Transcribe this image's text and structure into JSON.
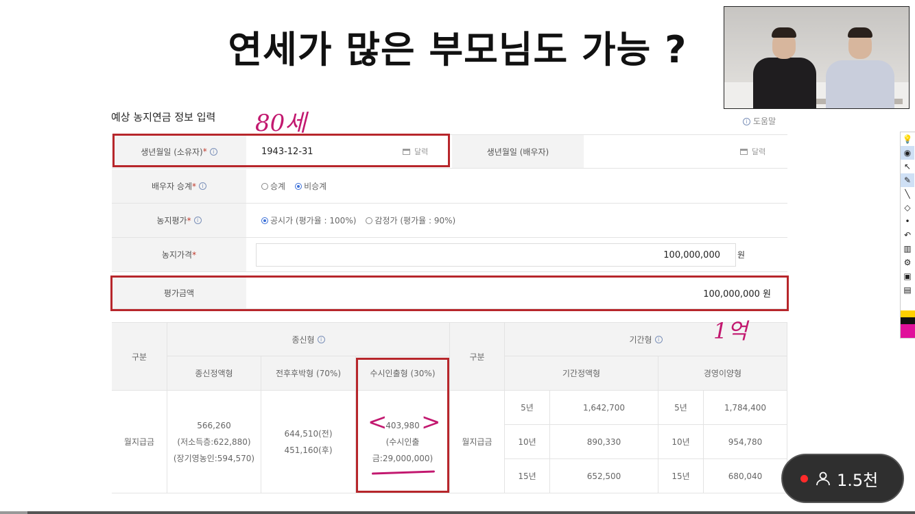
{
  "slide_title": "연세가 많은 부모님도 가능 ?",
  "form": {
    "title": "예상 농지연금 정보 입력",
    "help": "도움말",
    "info_glyph": "i",
    "required_mark": "*",
    "calendar_label": "달력",
    "birth_owner_label": "생년월일 (소유자)",
    "birth_owner_value": "1943-12-31",
    "birth_spouse_label": "생년월일 (배우자)",
    "spouse_succession_label": "배우자 승계",
    "succession_options": [
      "승계",
      "비승계"
    ],
    "succession_selected": "비승계",
    "land_eval_label": "농지평가",
    "land_eval_options": [
      "공시가 (평가율 : 100%)",
      "감정가 (평가율 : 90%)"
    ],
    "land_eval_selected": "공시가 (평가율 : 100%)",
    "land_price_label": "농지가격",
    "land_price_value": "100,000,000",
    "land_price_unit": "원",
    "eval_amount_label": "평가금액",
    "eval_amount_value": "100,000,000 원"
  },
  "result": {
    "gubun": "구분",
    "lifetime_header": "종신형",
    "term_header": "기간형",
    "sub_lifetime_fixed": "종신정액형",
    "sub_front_heavy": "전후후박형 (70%)",
    "sub_withdrawal": "수시인출형 (30%)",
    "sub_term_fixed": "기간정액형",
    "sub_transfer": "경영이양형",
    "row_label": "월지급금",
    "lifetime_fixed_values": [
      "566,260",
      "(저소득층:622,880)",
      "(장기영농인:594,570)"
    ],
    "front_heavy_values": [
      "644,510(전)",
      "451,160(후)"
    ],
    "withdrawal_values": [
      "403,980",
      "(수시인출",
      "금:29,000,000)"
    ],
    "term_rows": [
      {
        "period": "5년",
        "fixed": "1,642,700",
        "transfer": "1,784,400"
      },
      {
        "period": "10년",
        "fixed": "890,330",
        "transfer": "954,780"
      },
      {
        "period": "15년",
        "fixed": "652,500",
        "transfer": "680,040"
      }
    ]
  },
  "annotations": {
    "age_note": "80세",
    "amount_note": "1억",
    "bracket_left": "<",
    "bracket_right": ">"
  },
  "toolbar_icons": [
    "lightbulb-icon",
    "eye-icon",
    "cursor-icon",
    "highlighter-icon",
    "pen-icon",
    "eraser-icon",
    "dot-icon",
    "undo-icon",
    "trash-icon",
    "pen-settings-icon",
    "camera-icon",
    "clipboard-icon"
  ],
  "viewer_badge": {
    "count": "1.5천"
  },
  "colors": {
    "accent_red": "#b7262b",
    "pen_magenta": "#c2186f",
    "radio_blue": "#3a6fd8"
  }
}
